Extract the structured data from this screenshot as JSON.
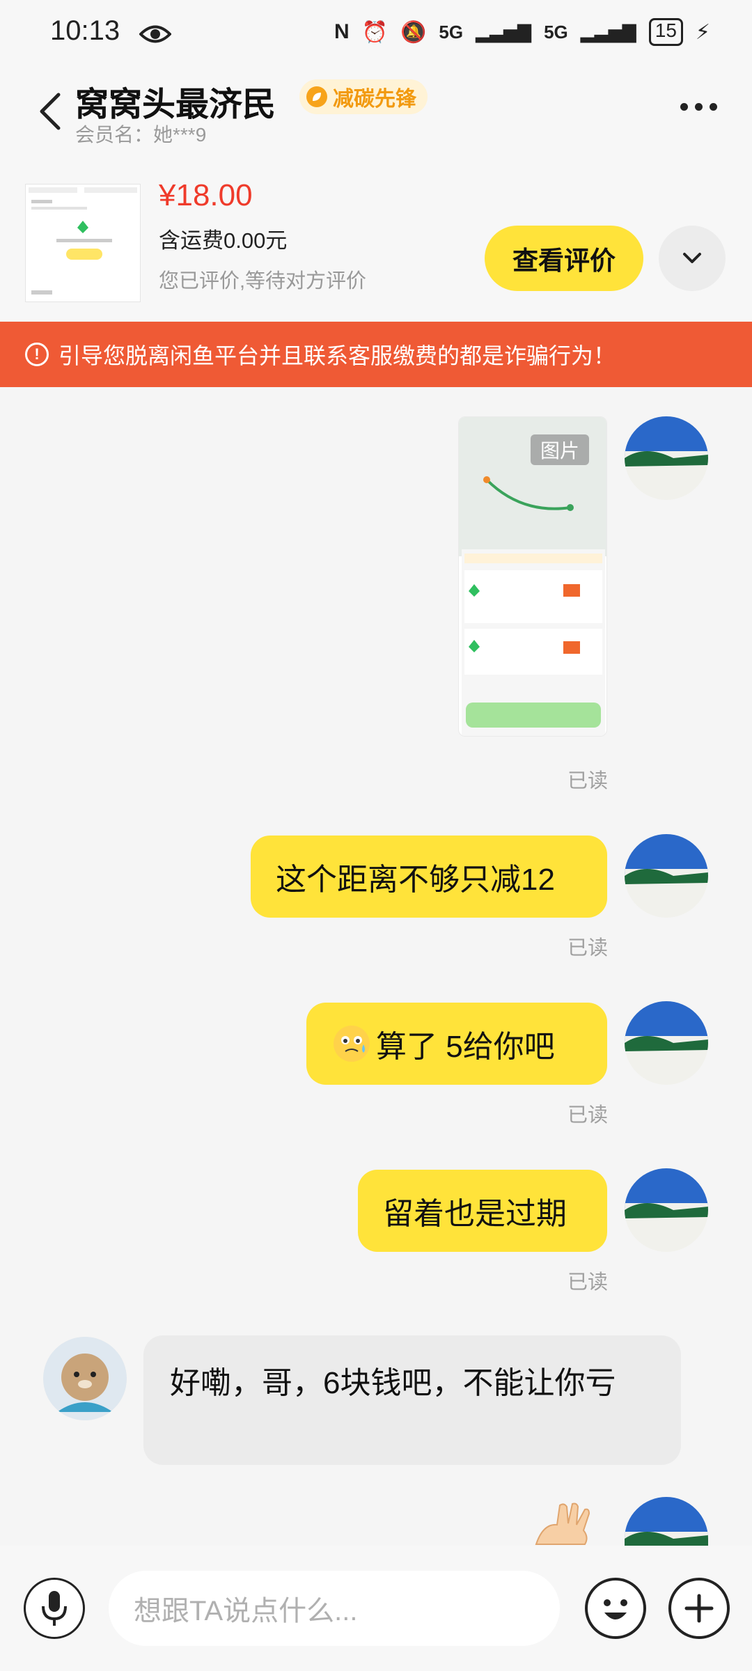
{
  "status_bar": {
    "time": "10:13",
    "signal1": "5G",
    "signal2": "5G",
    "battery": "15"
  },
  "header": {
    "title": "窝窝头最济民",
    "badge": "减碳先锋",
    "member_label": "会员名：她***9"
  },
  "product": {
    "price": "¥18.00",
    "shipping": "含运费0.00元",
    "review_status": "您已评价,等待对方评价",
    "review_button": "查看评价"
  },
  "warning": {
    "text": "引导您脱离闲鱼平台并且联系客服缴费的都是诈骗行为！"
  },
  "messages": {
    "image_tag": "图片",
    "read_label": "已读",
    "msg2": "这个距离不够只减12",
    "msg3": "算了  5给你吧",
    "msg4": "留着也是过期",
    "reply": "好嘞，哥，6块钱吧，不能让你亏"
  },
  "input_bar": {
    "placeholder": "想跟TA说点什么..."
  },
  "icons": {
    "back": "chevron-left-icon",
    "more": "more-dots-icon",
    "expand": "chevron-down-icon",
    "warn": "warning-circle-icon",
    "mic": "microphone-icon",
    "emoji": "emoji-icon",
    "plus": "plus-icon",
    "eye": "eye-icon"
  },
  "colors": {
    "accent": "#ffe33a",
    "price": "#ef3b2b",
    "warning_bg": "#ef5a35",
    "badge_text": "#f29a0f"
  }
}
